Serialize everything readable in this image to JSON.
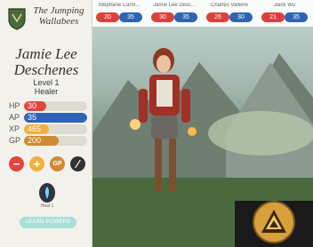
{
  "team": {
    "name": "The Jumping Wallabees"
  },
  "character": {
    "name": "Jamie Lee Deschenes",
    "level": "Level 1",
    "class": "Healer"
  },
  "stats": {
    "hp": {
      "label": "HP",
      "value": "30",
      "fraction": 0.35,
      "color": "#e0463c"
    },
    "ap": {
      "label": "AP",
      "value": "35",
      "fraction": 1.0,
      "color": "#2f64b3"
    },
    "xp": {
      "label": "XP",
      "value": "465",
      "fraction": 0.4,
      "color": "#f0b040"
    },
    "gp": {
      "label": "GP",
      "value": "200",
      "fraction": 0.55,
      "color": "#d08a32"
    }
  },
  "actions": [
    {
      "name": "minus",
      "glyph": "−",
      "color": "#e0463c"
    },
    {
      "name": "plus",
      "glyph": "+",
      "color": "#f0b040"
    },
    {
      "name": "gp",
      "glyph": "GP",
      "color": "#d08a32"
    },
    {
      "name": "toggle",
      "glyph": "⁄",
      "color": "#333333"
    }
  ],
  "power": {
    "label": "Heal 1"
  },
  "learn_button": "LEARN POWERS",
  "party": [
    {
      "name": "Stephane Carm...",
      "hp": "20",
      "ap": "35"
    },
    {
      "name": "Jamie Lee Desc...",
      "hp": "30",
      "ap": "35"
    },
    {
      "name": "Charles Vallière",
      "hp": "26",
      "ap": "30"
    },
    {
      "name": "Jianli Wu",
      "hp": "21",
      "ap": "35"
    }
  ]
}
